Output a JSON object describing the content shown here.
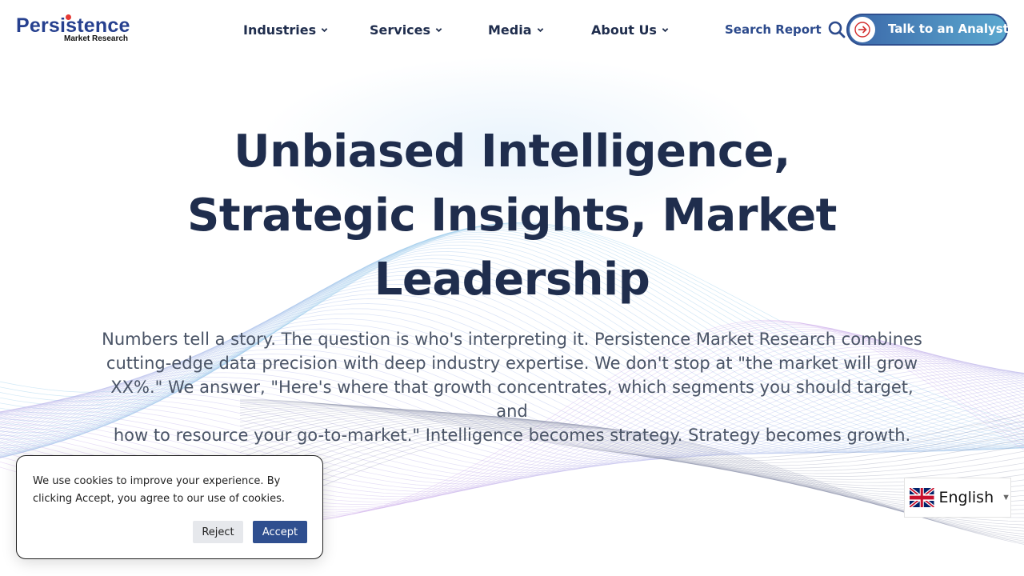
{
  "logo": {
    "main": "Persistence",
    "sub": "Market Research"
  },
  "nav": {
    "items": [
      {
        "label": "Industries"
      },
      {
        "label": "Services"
      },
      {
        "label": "Media"
      },
      {
        "label": "About Us"
      }
    ],
    "search_label": "Search Report",
    "cta_label": "Talk to an Analyst"
  },
  "hero": {
    "title_line1": "Unbiased Intelligence,",
    "title_line2": "Strategic Insights, Market",
    "title_line3": "Leadership",
    "text_line1": "Numbers tell a story. The question is who's interpreting it. Persistence Market Research combines",
    "text_line2": "cutting-edge data precision with deep industry expertise. We don't stop at \"the market will grow",
    "text_line3": "XX%.\" We answer, \"Here's where that growth concentrates, which segments you should target, and",
    "text_line4": "how to resource your go-to-market.\" Intelligence becomes strategy. Strategy becomes growth."
  },
  "cookie": {
    "text": "We use cookies to improve your experience. By clicking Accept, you agree to our use of cookies.",
    "reject_label": "Reject",
    "accept_label": "Accept"
  },
  "language": {
    "selected": "English",
    "flag": "uk-flag-icon"
  },
  "colors": {
    "navy": "#1f2d4d",
    "brand_blue": "#26408f",
    "button_blue": "#2f4f8f",
    "cta_gradient_end": "#5aa8cf",
    "logo_dot_red": "#e53935"
  },
  "icons": [
    "chevron-down-icon",
    "search-icon",
    "arrow-right-icon",
    "uk-flag-icon"
  ]
}
